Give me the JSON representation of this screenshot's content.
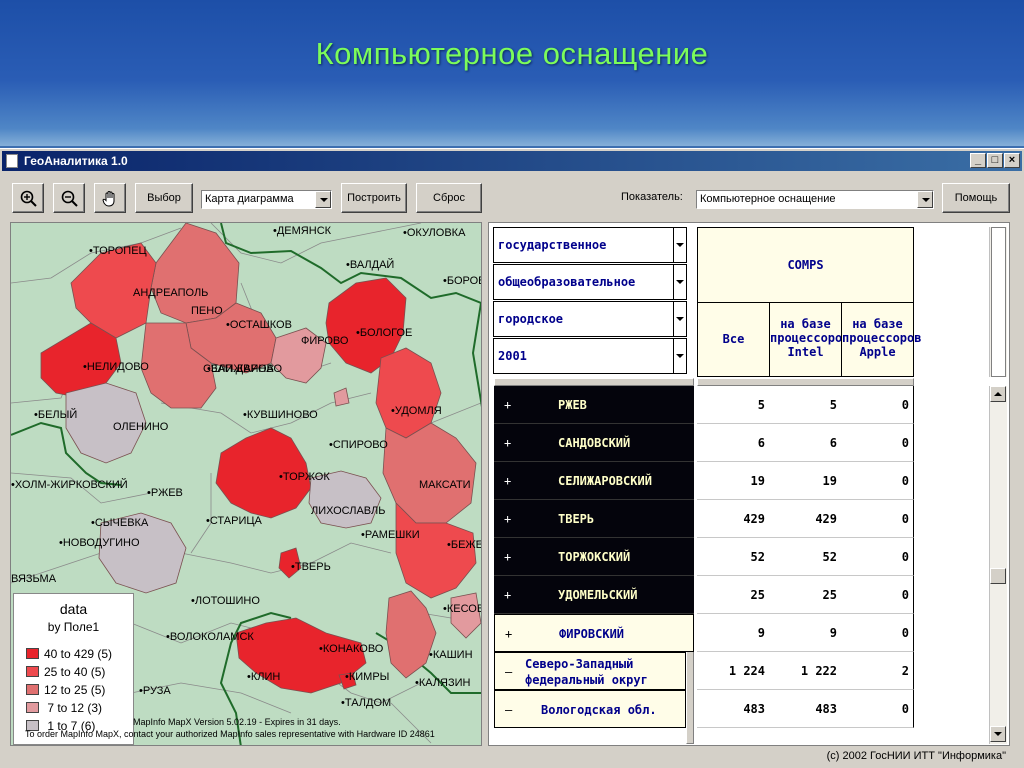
{
  "slide": {
    "title": "Компьютерное оснащение"
  },
  "window": {
    "title": "ГеоАналитика 1.0",
    "controls": {
      "minimize": "_",
      "maximize": "□",
      "close": "×"
    }
  },
  "toolbar": {
    "zoom_in_icon": "zoom-in-icon",
    "zoom_out_icon": "zoom-out-icon",
    "pan_icon": "hand-icon",
    "select_label": "Выбор",
    "map_type_value": "Карта диаграмма",
    "build_label": "Построить",
    "reset_label": "Сброс",
    "indicator_label": "Показатель:",
    "indicator_value": "Компьютерное оснащение",
    "help_label": "Помощь"
  },
  "map": {
    "labels": {
      "toropets": "•ТОРОПЕЦ",
      "demyansk": "•ДЕМЯНСК",
      "okulovka": "•ОКУЛОВКА",
      "valday": "•ВАЛДАЙ",
      "borovichi": "•БОРОВИ",
      "andreapol": "АНДРЕАПОЛЬ",
      "peno": "ПЕНО",
      "ostashkov": "•ОСТАШКОВ",
      "firovo": "ФИРОВО",
      "bologoe": "•БОЛОГОЕ",
      "zapadnaya_dvina": "•ЗАП.ДВИНА",
      "nelidovo": "•НЕЛИДОВО",
      "selizharovo": "СЕЛИЖАРОВО",
      "udomlya": "•УДОМЛЯ",
      "belyy": "•БЕЛЫЙ",
      "olenino": "ОЛЕНИНО",
      "kuvshinovo": "•КУВШИНОВО",
      "spirovo": "•СПИРОВО",
      "kholm_zhirkovskiy": "•ХОЛМ-ЖИРКОВСКИЙ",
      "rzhev": "•РЖЕВ",
      "torzhok": "•ТОРЖОК",
      "maksatikha": "МАКСАТИ",
      "likhoslavl": "ЛИХОСЛАВЛЬ",
      "sychevka": "•СЫЧЕВКА",
      "staritsa": "•СТАРИЦА",
      "ramenki": "•РАМЕШКИ",
      "novoduginno": "•НОВОДУГИНО",
      "bezhetsk": "•БЕЖЕ",
      "vyazma": "ВЯЗЬМА",
      "tver": "•ТВЕРЬ",
      "lotoshino": "•ЛОТОШИНО",
      "kesova": "•КЕСОВ",
      "volokolamsk": "•ВОЛОКОЛАМСК",
      "konakovo": "•КОНАКОВО",
      "kashin": "•КАШИН",
      "klin": "•КЛИН",
      "kimry": "•КИМРЫ",
      "kalyazin": "•КАЛЯЗИН",
      "ruza": "•РУЗА",
      "taldom": "•ТАЛДОМ"
    },
    "legend": {
      "title": "data",
      "subtitle": "by Поле1",
      "items": [
        {
          "range": "40 to 429",
          "count": "(5)",
          "color": "#e8242c"
        },
        {
          "range": "25 to  40",
          "count": "(5)",
          "color": "#ee4a4e"
        },
        {
          "range": "12 to  25",
          "count": "(5)",
          "color": "#e07070"
        },
        {
          "range": " 7 to  12",
          "count": "(3)",
          "color": "#e29a9e"
        },
        {
          "range": " 1 to   7",
          "count": "(6)",
          "color": "#c7c0c6"
        }
      ]
    },
    "note_line1": "MapInfo MapX Version 5.02.19 - Expires in 31 days.",
    "note_line2": "To order MapInfo MapX, contact your authorized MapInfo sales representative with Hardware ID 24861"
  },
  "pivot": {
    "dimensions": [
      "государственное",
      "общеобразовательное",
      "городское",
      "2001"
    ],
    "header_top": "COMPS",
    "col_headers": [
      "Все",
      "на базе процессоров Intel",
      "на базе процессоров Apple"
    ],
    "rows": [
      {
        "expander": "+",
        "name": "РЖЕВ",
        "all": "5",
        "intel": "5",
        "apple": "0"
      },
      {
        "expander": "+",
        "name": "САНДОВСКИЙ",
        "all": "6",
        "intel": "6",
        "apple": "0"
      },
      {
        "expander": "+",
        "name": "СЕЛИЖАРОВСКИЙ",
        "all": "19",
        "intel": "19",
        "apple": "0"
      },
      {
        "expander": "+",
        "name": "ТВЕРЬ",
        "all": "429",
        "intel": "429",
        "apple": "0"
      },
      {
        "expander": "+",
        "name": "ТОРЖОКСКИЙ",
        "all": "52",
        "intel": "52",
        "apple": "0"
      },
      {
        "expander": "+",
        "name": "УДОМЕЛЬСКИЙ",
        "all": "25",
        "intel": "25",
        "apple": "0"
      },
      {
        "expander": "+",
        "name": "ФИРОВСКИЙ",
        "all": "9",
        "intel": "9",
        "apple": "0"
      },
      {
        "expander": "–",
        "name": "Северо-Западный федеральный округ",
        "name_line1": "Северо-Западный",
        "name_line2": "федеральный округ",
        "all": "1 224",
        "intel": "1 222",
        "apple": "2"
      },
      {
        "expander": "–",
        "name": "Вологодская обл.",
        "all": "483",
        "intel": "483",
        "apple": "0"
      }
    ]
  },
  "footer": {
    "copyright": "(c) 2002 ГосНИИ ИТТ \"Информика\""
  }
}
